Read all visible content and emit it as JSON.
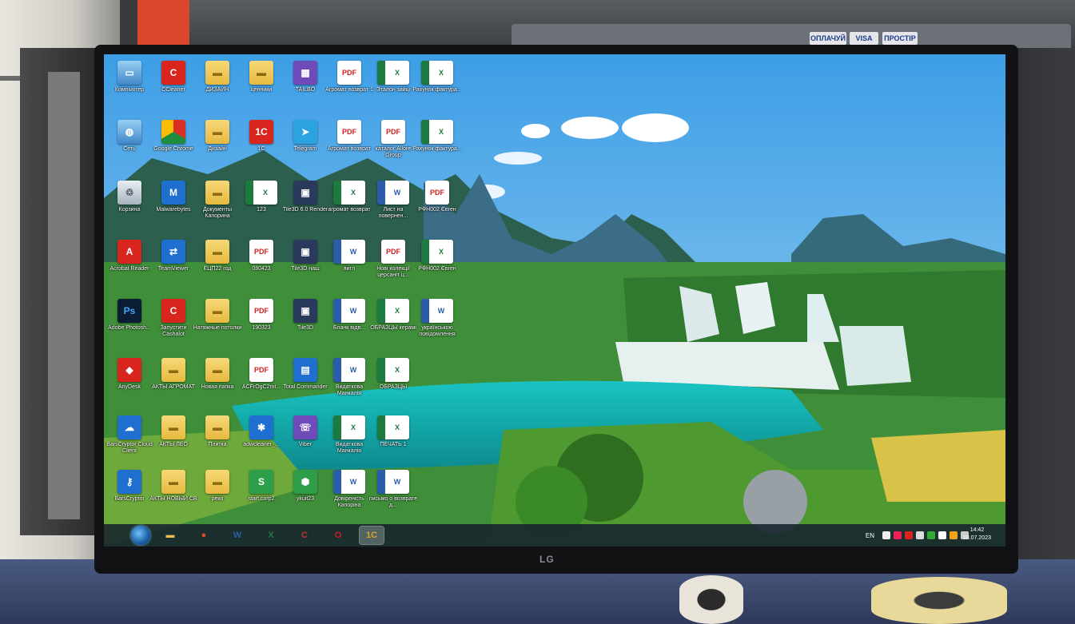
{
  "surroundings": {
    "badges": [
      "ОПЛАЧУЙ",
      "VISA",
      "ПРОСТІР"
    ],
    "monitor_brand": "LG"
  },
  "desktop": {
    "icons": [
      {
        "label": "Компьютер",
        "icon": "computer-icon",
        "style": "g-pc",
        "glyph": "▭"
      },
      {
        "label": "CCleaner",
        "icon": "ccleaner-icon",
        "style": "g-red",
        "glyph": "C"
      },
      {
        "label": "ДИЗАЙН",
        "icon": "folder-icon",
        "style": "g-folder",
        "glyph": "▬"
      },
      {
        "label": "ценники",
        "icon": "folder-icon",
        "style": "g-folder",
        "glyph": "▬"
      },
      {
        "label": "TAILBO",
        "icon": "winrar-icon",
        "style": "g-purple",
        "glyph": "▦"
      },
      {
        "label": "Агромат возврат 1",
        "icon": "pdf-icon",
        "style": "g-pdf",
        "glyph": "PDF"
      },
      {
        "label": "Эталон зайці",
        "icon": "excel-icon",
        "style": "g-excel",
        "glyph": "X"
      },
      {
        "label": "Рахунок фактура...",
        "icon": "excel-icon",
        "style": "g-excel",
        "glyph": "X"
      },
      {
        "label": "Сеть",
        "icon": "network-icon",
        "style": "g-pc",
        "glyph": "◍"
      },
      {
        "label": "Google Chrome",
        "icon": "chrome-icon",
        "style": "g-chrome",
        "glyph": ""
      },
      {
        "label": "Дизайн",
        "icon": "folder-icon",
        "style": "g-folder",
        "glyph": "▬"
      },
      {
        "label": "1С",
        "icon": "onec-icon",
        "style": "g-red",
        "glyph": "1С"
      },
      {
        "label": "Telegram",
        "icon": "telegram-icon",
        "style": "g-tele",
        "glyph": "➤"
      },
      {
        "label": "Агромат возврат",
        "icon": "pdf-icon",
        "style": "g-pdf",
        "glyph": "PDF"
      },
      {
        "label": "каталог Allore Group",
        "icon": "pdf-icon",
        "style": "g-pdf",
        "glyph": "PDF"
      },
      {
        "label": "Рахунок фактура...",
        "icon": "excel-icon",
        "style": "g-excel",
        "glyph": "X"
      },
      {
        "label": "Корзина",
        "icon": "recycle-bin-icon",
        "style": "g-bin",
        "glyph": "♲"
      },
      {
        "label": "Malwarebytes",
        "icon": "malwarebytes-icon",
        "style": "g-blue",
        "glyph": "M"
      },
      {
        "label": "Документы Капорина",
        "icon": "folder-icon",
        "style": "g-folder",
        "glyph": "▬"
      },
      {
        "label": "123",
        "icon": "excel-icon",
        "style": "g-excel",
        "glyph": "X"
      },
      {
        "label": "Tile3D 6.0 Render",
        "icon": "tile3d-icon",
        "style": "g-dark",
        "glyph": "▣"
      },
      {
        "label": "агромат возврат",
        "icon": "excel-icon",
        "style": "g-excel",
        "glyph": "X"
      },
      {
        "label": "Лист на повернен...",
        "icon": "word-icon",
        "style": "g-word",
        "glyph": "W"
      },
      {
        "label": "РФН002 Євген",
        "icon": "pdf-icon",
        "style": "g-pdf",
        "glyph": "PDF"
      },
      {
        "label": "Acrobat Reader",
        "icon": "acrobat-icon",
        "style": "g-red",
        "glyph": "A"
      },
      {
        "label": "TeamViewer",
        "icon": "teamviewer-icon",
        "style": "g-blue",
        "glyph": "⇄"
      },
      {
        "label": "ЕЦП22 год",
        "icon": "folder-icon",
        "style": "g-folder",
        "glyph": "▬"
      },
      {
        "label": "080423",
        "icon": "pdf-icon",
        "style": "g-pdf",
        "glyph": "PDF"
      },
      {
        "label": "Tile3D наш",
        "icon": "tile3d-icon",
        "style": "g-dark",
        "glyph": "▣"
      },
      {
        "label": "вигл",
        "icon": "word-icon",
        "style": "g-word",
        "glyph": "W"
      },
      {
        "label": "Нові колекції церсаніт ц...",
        "icon": "pdf-icon",
        "style": "g-pdf",
        "glyph": "PDF"
      },
      {
        "label": "РФН002 Євген",
        "icon": "excel-icon",
        "style": "g-excel",
        "glyph": "X"
      },
      {
        "label": "Adobe Photosh...",
        "icon": "photoshop-icon",
        "style": "g-ps",
        "glyph": "Ps"
      },
      {
        "label": "Запустити Cashalot",
        "icon": "cashalot-icon",
        "style": "g-red",
        "glyph": "C"
      },
      {
        "label": "Натяжные потолки",
        "icon": "folder-icon",
        "style": "g-folder",
        "glyph": "▬"
      },
      {
        "label": "190323",
        "icon": "pdf-icon",
        "style": "g-pdf",
        "glyph": "PDF"
      },
      {
        "label": "Tile3D",
        "icon": "tile3d-icon",
        "style": "g-dark",
        "glyph": "▣"
      },
      {
        "label": "Бланк відв...",
        "icon": "word-icon",
        "style": "g-word",
        "glyph": "W"
      },
      {
        "label": "ОБРАЗЦЫ керамі",
        "icon": "excel-icon",
        "style": "g-excel",
        "glyph": "X"
      },
      {
        "label": "українською повідомлення",
        "icon": "word-icon",
        "style": "g-word",
        "glyph": "W"
      },
      {
        "label": "AnyDesk",
        "icon": "anydesk-icon",
        "style": "g-red",
        "glyph": "◆"
      },
      {
        "label": "АКТЫ АГРОМАТ",
        "icon": "folder-icon",
        "style": "g-folder",
        "glyph": "▬"
      },
      {
        "label": "Новая папка",
        "icon": "folder-icon",
        "style": "g-folder",
        "glyph": "▬"
      },
      {
        "label": "ACFrOgC2mt...",
        "icon": "pdf-icon",
        "style": "g-pdf",
        "glyph": "PDF"
      },
      {
        "label": "Total Commander",
        "icon": "total-commander-icon",
        "style": "g-blue",
        "glyph": "▤"
      },
      {
        "label": "Видаткова Манкалія",
        "icon": "word-icon",
        "style": "g-word",
        "glyph": "W"
      },
      {
        "label": "ОБРАЗЦЫ",
        "icon": "excel-icon",
        "style": "g-excel",
        "glyph": "X"
      },
      {
        "label": "BarsCryptor Cloud Client",
        "icon": "cloud-icon",
        "style": "g-blue",
        "glyph": "☁"
      },
      {
        "label": "АКТЫ ЛЕО",
        "icon": "folder-icon",
        "style": "g-folder",
        "glyph": "▬"
      },
      {
        "label": "Плитка",
        "icon": "folder-icon",
        "style": "g-folder",
        "glyph": "▬"
      },
      {
        "label": "adwcleaner_...",
        "icon": "adwcleaner-icon",
        "style": "g-blue",
        "glyph": "✱"
      },
      {
        "label": "Viber",
        "icon": "viber-icon",
        "style": "g-purple",
        "glyph": "☏"
      },
      {
        "label": "Видаткова Манкалія",
        "icon": "excel-icon",
        "style": "g-excel",
        "glyph": "X"
      },
      {
        "label": "ПЕЧАТЬ 1",
        "icon": "excel-icon",
        "style": "g-excel",
        "glyph": "X"
      },
      {
        "label": "BarsCryptor",
        "icon": "usb-key-icon",
        "style": "g-blue",
        "glyph": "⚷"
      },
      {
        "label": "АКТЫ НОВЫЙ СВ",
        "icon": "folder-icon",
        "style": "g-folder",
        "glyph": "▬"
      },
      {
        "label": "реко",
        "icon": "folder-icon",
        "style": "g-folder",
        "glyph": "▬"
      },
      {
        "label": "start.corp2",
        "icon": "shortcut-icon",
        "style": "g-green",
        "glyph": "S"
      },
      {
        "label": "ykuit23",
        "icon": "ykuit-icon",
        "style": "g-green",
        "glyph": "⬢"
      },
      {
        "label": "Довіреність Капоріна",
        "icon": "word-icon",
        "style": "g-word",
        "glyph": "W"
      },
      {
        "label": "письмо о возврате д...",
        "icon": "word-icon",
        "style": "g-word",
        "glyph": "W"
      }
    ]
  },
  "taskbar": {
    "apps": [
      {
        "name": "explorer-icon",
        "glyph": "▬",
        "color": "#e8c04a"
      },
      {
        "name": "chrome-icon",
        "glyph": "●",
        "color": "#e34b2a"
      },
      {
        "name": "word-icon",
        "glyph": "W",
        "color": "#2a5caa"
      },
      {
        "name": "excel-icon",
        "glyph": "X",
        "color": "#1d7a3f"
      },
      {
        "name": "cashalot-icon",
        "glyph": "C",
        "color": "#cf2a2a"
      },
      {
        "name": "opera-icon",
        "glyph": "O",
        "color": "#d61b1b"
      },
      {
        "name": "onec-icon",
        "glyph": "1С",
        "color": "#d8a52a"
      }
    ],
    "language": "EN",
    "time": "14:42",
    "date": "18.07.2023"
  }
}
